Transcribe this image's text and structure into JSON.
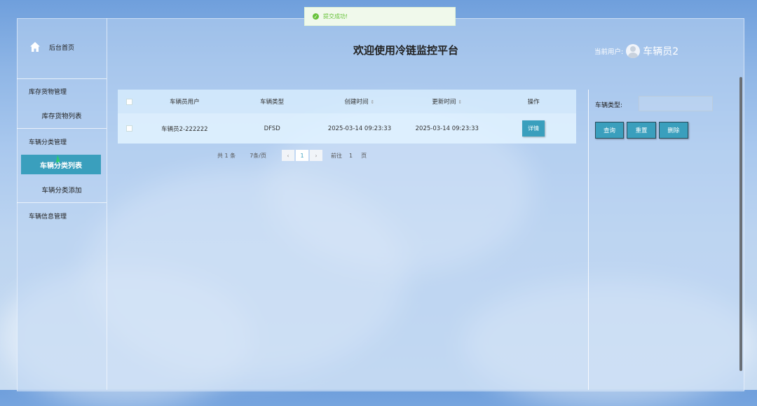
{
  "toast": {
    "text": "提交成功!"
  },
  "sidebar": {
    "home_label": "后台首页",
    "groups": [
      {
        "title": "库存货物管理",
        "items": [
          "库存货物列表"
        ]
      },
      {
        "title": "车辆分类管理",
        "items": [
          "车辆分类列表",
          "车辆分类添加"
        ]
      },
      {
        "title": "车辆信息管理",
        "items": []
      }
    ],
    "active_item": "车辆分类列表"
  },
  "header": {
    "title": "欢迎使用冷链监控平台",
    "user_label": "当前用户:",
    "user_name": "车辆员2"
  },
  "table": {
    "columns": [
      "车辆员用户",
      "车辆类型",
      "创建时间",
      "更新时间",
      "操作"
    ],
    "rows": [
      {
        "user": "车辆员2-222222",
        "type": "DFSD",
        "created": "2025-03-14 09:23:33",
        "updated": "2025-03-14 09:23:33",
        "action": "详情"
      }
    ]
  },
  "pagination": {
    "total": "共 1 条",
    "page_size": "7条/页",
    "current_page": "1",
    "goto_label": "前往",
    "goto_value": "1",
    "page_unit": "页"
  },
  "filter": {
    "label": "车辆类型:",
    "input_value": "",
    "buttons": {
      "search": "查询",
      "reset": "重置",
      "delete": "删除"
    }
  },
  "colors": {
    "accent": "#3a9fbd",
    "success": "#67c23a"
  }
}
